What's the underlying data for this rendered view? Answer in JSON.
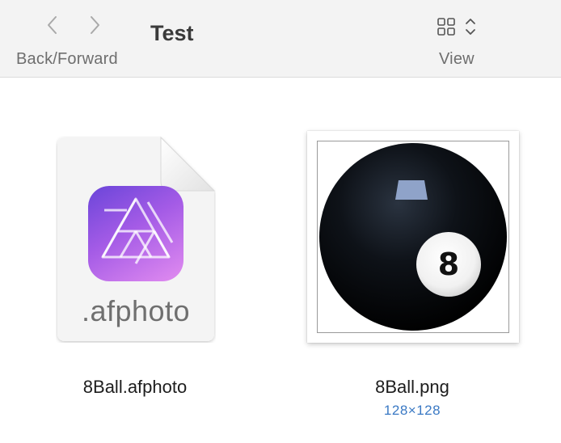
{
  "toolbar": {
    "back_forward_label": "Back/Forward",
    "title": "Test",
    "view_label": "View",
    "back_icon": "chevron-left-icon",
    "forward_icon": "chevron-right-icon",
    "view_icon": "grid-view-icon",
    "view_stepper_icon": "up-down-chevron-icon"
  },
  "files": [
    {
      "name": "8Ball.afphoto",
      "icon": "affinity-photo-document-icon",
      "extension_label": ".afphoto",
      "accent_colors": [
        "#6a45d9",
        "#e28cf0"
      ]
    },
    {
      "name": "8Ball.png",
      "icon": "eight-ball-thumbnail",
      "dimensions": "128×128",
      "ball_number": "8"
    }
  ],
  "colors": {
    "toolbar_bg": "#f3f3f3",
    "dimensions_text": "#3a79c4"
  }
}
